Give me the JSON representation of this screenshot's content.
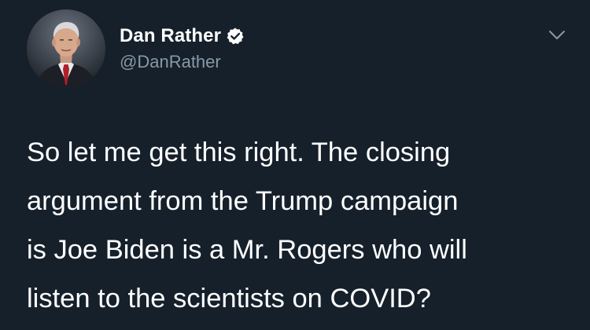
{
  "author": {
    "display_name": "Dan Rather",
    "handle": "@DanRather",
    "verified": true,
    "avatar_icon": "profile-photo"
  },
  "menu_icon": "chevron-down-icon",
  "tweet": {
    "lines": [
      "So let me get this right. The closing",
      "argument from the Trump campaign",
      "is Joe Biden is a Mr. Rogers who will",
      "listen to the scientists on COVID?"
    ]
  },
  "colors": {
    "background": "#15202b",
    "text": "#ffffff",
    "secondary_text": "#8899a6",
    "verified": "#ffffff"
  }
}
